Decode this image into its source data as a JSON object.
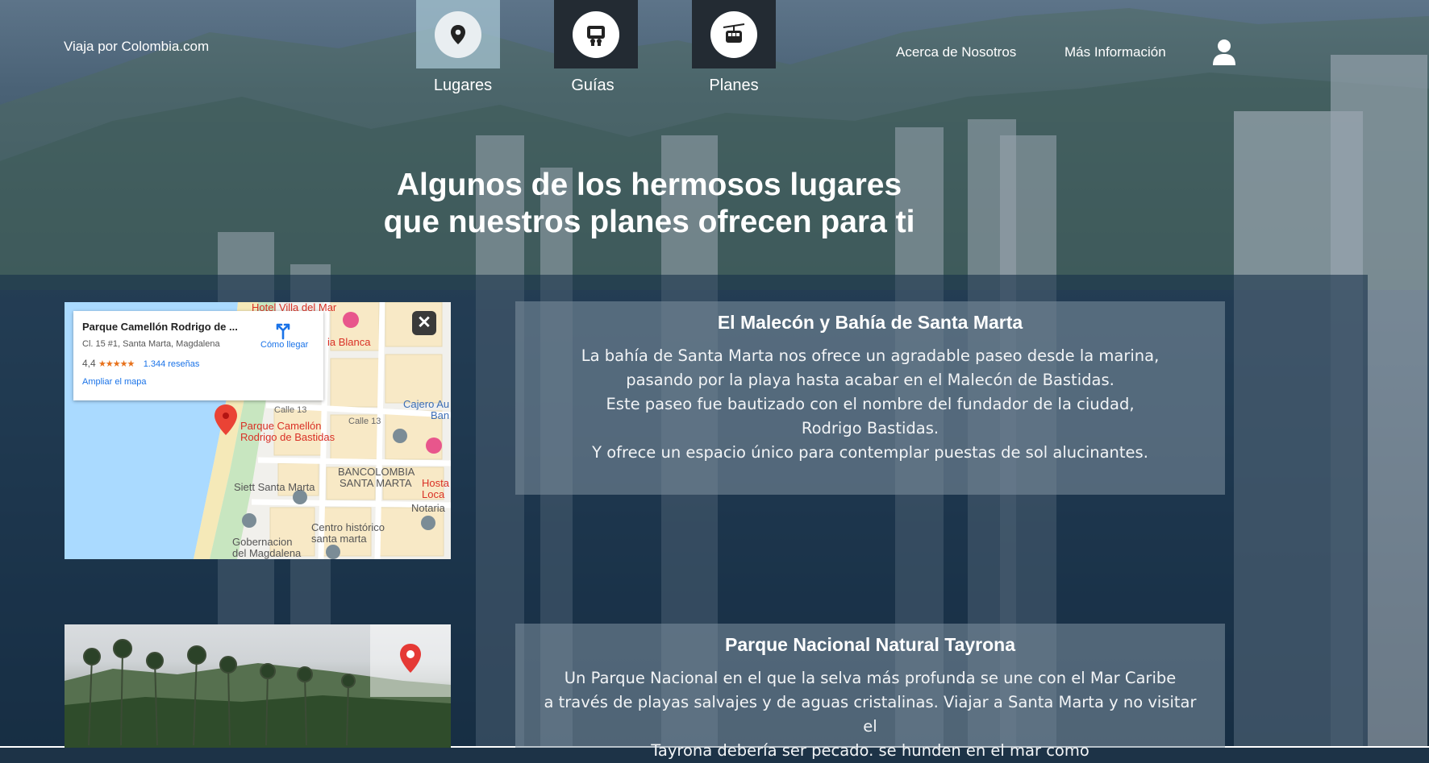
{
  "header": {
    "brand": "Viaja por Colombia.com",
    "nav": [
      {
        "label": "Lugares",
        "icon": "location-pin-icon"
      },
      {
        "label": "Guías",
        "icon": "guide-icon"
      },
      {
        "label": "Planes",
        "icon": "cable-car-icon"
      }
    ],
    "links": [
      "Acerca de Nosotros",
      "Más Información"
    ],
    "user_icon": "user-icon"
  },
  "hero": {
    "line1": "Algunos de los hermosos lugares",
    "line2": "que nuestros planes ofrecen para ti"
  },
  "map": {
    "place_name": "Parque Camellón Rodrigo de ...",
    "address": "Cl. 15 #1, Santa Marta, Magdalena",
    "rating": "4,4",
    "stars": "★★★★★",
    "reviews": "1.344 reseñas",
    "expand": "Ampliar el mapa",
    "directions": "Cómo llegar",
    "close": "✕",
    "labels": {
      "hotel": "Hotel Villa del Mar",
      "playa": "ia Blanca",
      "calle13a": "Calle 13",
      "calle13b": "Calle 13",
      "cajero1": "Cajero Au",
      "cajero2": "Ban",
      "park1": "Parque Camellón",
      "park2": "Rodrigo de Bastidas",
      "banco1": "BANCOLOMBIA",
      "banco2": "SANTA MARTA",
      "hostal1": "Hosta",
      "hostal2": "Loca",
      "siett": "Siett Santa Marta",
      "notaria": "Notaria",
      "centro1": "Centro histórico",
      "centro2": "santa marta",
      "gob1": "Gobernacion",
      "gob2": "del Magdalena"
    }
  },
  "cards": [
    {
      "title": "El Malecón y Bahía de Santa Marta",
      "lines": [
        "La bahía de Santa Marta nos ofrece un agradable paseo desde la marina,",
        "pasando por la playa hasta acabar en el Malecón de Bastidas.",
        "Este paseo fue bautizado con el nombre del fundador de la ciudad,",
        "Rodrigo Bastidas.",
        "Y ofrece un espacio único para contemplar puestas de sol alucinantes."
      ]
    },
    {
      "title": "Parque Nacional Natural Tayrona",
      "lines": [
        "Un Parque Nacional en el que la selva más profunda se une con el Mar Caribe",
        "a través de playas salvajes y de aguas cristalinas. Viajar a Santa Marta y no visitar el",
        "Tayrona debería ser pecado. se hunden en el mar como"
      ]
    }
  ],
  "colors": {
    "pin_red": "#e53935",
    "nav_active": "#a6c4d2",
    "nav_dark": "#232b33"
  }
}
